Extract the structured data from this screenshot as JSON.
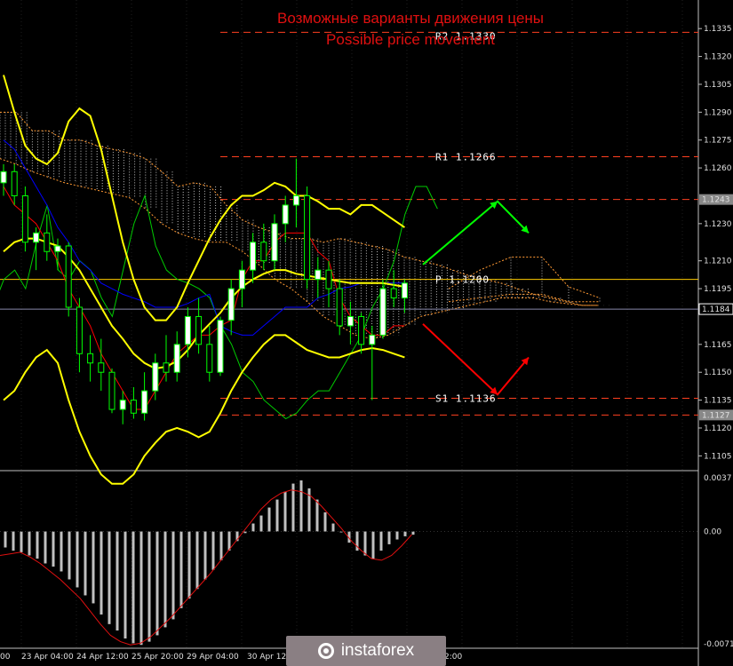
{
  "header": {
    "title_ru": "Возможные варианты движения цены",
    "title_en": "Possible price movement"
  },
  "logo": {
    "text": "instaforex"
  },
  "colors": {
    "background": "#000000",
    "bull_candle": "#ffffff",
    "bear_candle": "#000000",
    "candle_wick": "#00ff00",
    "bollinger": "#ffff00",
    "kijun": "#ff0000",
    "tenkun": "#0000ff",
    "chikou": "#00cc00",
    "level_line": "#ff4020",
    "pivot_line": "#ffcc00",
    "up_arrow": "#00ff00",
    "down_arrow": "#ff0000",
    "kumo": "#ff9933"
  },
  "chart_data": [
    {
      "type": "line",
      "title": "",
      "ylim": [
        1.1098,
        1.1348
      ],
      "y_ticks": [
        "1.1335",
        "1.1320",
        "1.1305",
        "1.1290",
        "1.1275",
        "1.1260",
        "1.1243",
        "1.1230",
        "1.1210",
        "1.1195",
        "1.1184",
        "1.1165",
        "1.1150",
        "1.1135",
        "1.1127",
        "1.1120",
        "1.1105"
      ],
      "x_ticks": [
        "00",
        "23 Apr 04:00",
        "24 Apr 12:00",
        "25 Apr 20:00",
        "29 Apr 04:00",
        "30 Apr 12:00",
        "2:00"
      ],
      "levels": [
        {
          "label": "R2",
          "value": "1.1330",
          "price": 1.1333
        },
        {
          "label": "R1",
          "value": "1.1266",
          "price": 1.1266
        },
        {
          "label": "P",
          "value": "1.1200",
          "price": 1.12
        },
        {
          "label": "S1",
          "value": "1.1136",
          "price": 1.1136
        }
      ],
      "price_tags": [
        {
          "value": "1.1243",
          "price": 1.1243
        },
        {
          "value": "1.1184",
          "price": 1.1184
        },
        {
          "value": "1.1127",
          "price": 1.1127
        }
      ],
      "candles": [
        [
          1.1252,
          1.1262,
          1.1245,
          1.1258
        ],
        [
          1.1258,
          1.1262,
          1.124,
          1.1245
        ],
        [
          1.1245,
          1.125,
          1.1215,
          1.122
        ],
        [
          1.122,
          1.1228,
          1.1205,
          1.1225
        ],
        [
          1.1225,
          1.1235,
          1.121,
          1.1215
        ],
        [
          1.1215,
          1.1222,
          1.1205,
          1.1218
        ],
        [
          1.1218,
          1.122,
          1.118,
          1.1185
        ],
        [
          1.1185,
          1.119,
          1.115,
          1.116
        ],
        [
          1.116,
          1.117,
          1.1145,
          1.1155
        ],
        [
          1.1155,
          1.1168,
          1.114,
          1.115
        ],
        [
          1.115,
          1.1152,
          1.1128,
          1.113
        ],
        [
          1.113,
          1.114,
          1.1122,
          1.1135
        ],
        [
          1.1135,
          1.1142,
          1.1125,
          1.1128
        ],
        [
          1.1128,
          1.115,
          1.1124,
          1.114
        ],
        [
          1.114,
          1.116,
          1.1135,
          1.1155
        ],
        [
          1.1155,
          1.117,
          1.1145,
          1.115
        ],
        [
          1.115,
          1.1172,
          1.1145,
          1.1165
        ],
        [
          1.1165,
          1.1185,
          1.1158,
          1.118
        ],
        [
          1.118,
          1.119,
          1.116,
          1.1165
        ],
        [
          1.1165,
          1.1175,
          1.1145,
          1.115
        ],
        [
          1.115,
          1.118,
          1.1148,
          1.1178
        ],
        [
          1.1178,
          1.12,
          1.117,
          1.1195
        ],
        [
          1.1195,
          1.121,
          1.1185,
          1.1205
        ],
        [
          1.1205,
          1.1225,
          1.1198,
          1.122
        ],
        [
          1.122,
          1.123,
          1.1205,
          1.121
        ],
        [
          1.121,
          1.1235,
          1.1205,
          1.123
        ],
        [
          1.123,
          1.1245,
          1.122,
          1.124
        ],
        [
          1.124,
          1.1265,
          1.1228,
          1.1245
        ],
        [
          1.1245,
          1.125,
          1.1195,
          1.12
        ],
        [
          1.12,
          1.1212,
          1.119,
          1.1205
        ],
        [
          1.1205,
          1.121,
          1.1185,
          1.1195
        ],
        [
          1.1195,
          1.12,
          1.117,
          1.1175
        ],
        [
          1.1175,
          1.1188,
          1.1165,
          1.118
        ],
        [
          1.118,
          1.1182,
          1.116,
          1.1165
        ],
        [
          1.1165,
          1.1175,
          1.1135,
          1.117
        ],
        [
          1.117,
          1.12,
          1.1168,
          1.1195
        ],
        [
          1.1195,
          1.1205,
          1.1185,
          1.119
        ],
        [
          1.119,
          1.12,
          1.1182,
          1.1198
        ]
      ],
      "bollinger_upper": [
        1.131,
        1.129,
        1.1272,
        1.1265,
        1.1262,
        1.1268,
        1.1285,
        1.1292,
        1.1288,
        1.127,
        1.1245,
        1.122,
        1.12,
        1.1185,
        1.1178,
        1.1178,
        1.1185,
        1.1198,
        1.121,
        1.1222,
        1.1232,
        1.124,
        1.1245,
        1.1245,
        1.1248,
        1.1252,
        1.125,
        1.1245,
        1.1245,
        1.1242,
        1.1238,
        1.1238,
        1.1235,
        1.124,
        1.124,
        1.1236,
        1.1232,
        1.1228
      ],
      "bollinger_mid": [
        1.1215,
        1.122,
        1.1222,
        1.1222,
        1.122,
        1.1218,
        1.1212,
        1.1205,
        1.1195,
        1.1185,
        1.1175,
        1.1168,
        1.116,
        1.1155,
        1.1152,
        1.1153,
        1.1156,
        1.1162,
        1.117,
        1.1176,
        1.1182,
        1.119,
        1.1196,
        1.12,
        1.1203,
        1.1205,
        1.1205,
        1.1203,
        1.1202,
        1.1201,
        1.12,
        1.1199,
        1.1198,
        1.1198,
        1.1198,
        1.1198,
        1.1197,
        1.1196
      ],
      "bollinger_lower": [
        1.1135,
        1.114,
        1.115,
        1.1158,
        1.1162,
        1.1155,
        1.1135,
        1.1118,
        1.1105,
        1.1095,
        1.109,
        1.109,
        1.1095,
        1.1105,
        1.1112,
        1.1118,
        1.112,
        1.1118,
        1.1115,
        1.1118,
        1.1128,
        1.114,
        1.115,
        1.1158,
        1.1165,
        1.117,
        1.117,
        1.1166,
        1.1162,
        1.116,
        1.1158,
        1.1158,
        1.116,
        1.1162,
        1.1163,
        1.1162,
        1.116,
        1.1158
      ],
      "kijun": [
        1.125,
        1.124,
        1.1235,
        1.123,
        1.122,
        1.121,
        1.1195,
        1.1185,
        1.1175,
        1.116,
        1.115,
        1.114,
        1.113,
        1.113,
        1.114,
        1.115,
        1.116,
        1.1165,
        1.117,
        1.117,
        1.1175,
        1.1178,
        1.12,
        1.121,
        1.121,
        1.122,
        1.1225,
        1.1225,
        1.1225,
        1.1215,
        1.121,
        1.119,
        1.118,
        1.1175,
        1.117,
        1.117,
        1.1175,
        1.1175
      ],
      "tenkan": [
        1.1275,
        1.127,
        1.126,
        1.125,
        1.124,
        1.1228,
        1.122,
        1.121,
        1.1205,
        1.1198,
        1.1195,
        1.1192,
        1.119,
        1.1188,
        1.1185,
        1.1185,
        1.1185,
        1.1187,
        1.119,
        1.1192,
        1.1175,
        1.1172,
        1.117,
        1.117,
        1.1175,
        1.118,
        1.1185,
        1.1185,
        1.1185,
        1.119,
        1.1192,
        1.1195,
        1.1196,
        1.1198,
        1.1198,
        1.1198,
        1.1198,
        1.1198
      ],
      "chikou": [
        1.1165,
        1.1185,
        1.12,
        1.1205,
        1.1195,
        1.122,
        1.124,
        1.1205,
        1.12,
        1.121,
        1.1205,
        1.119,
        1.118,
        1.1205,
        1.123,
        1.1245,
        1.1218,
        1.1205,
        1.12,
        1.1198,
        1.1195,
        1.119,
        1.1175,
        1.1165,
        1.115,
        1.1145,
        1.1135,
        1.113,
        1.1125,
        1.1128,
        1.1135,
        1.114,
        1.114,
        1.115,
        1.116,
        1.117,
        1.1185,
        1.1195,
        1.121,
        1.1235,
        1.125,
        1.125,
        1.1238
      ],
      "kumo_top": [
        1.129,
        1.129,
        1.128,
        1.128,
        1.1275,
        1.1275,
        1.1272,
        1.127,
        1.1268,
        1.1265,
        1.1258,
        1.125,
        1.1252,
        1.125,
        1.124,
        1.1232,
        1.1228,
        1.1225,
        1.1222,
        1.1222,
        1.122,
        1.1222,
        1.122,
        1.1218,
        1.1216,
        1.1212,
        1.121,
        1.1208,
        1.1205,
        1.1202,
        1.12,
        1.1198,
        1.1195,
        1.1192,
        1.119,
        1.1188,
        1.1186,
        1.1186
      ],
      "kumo_bottom": [
        1.1265,
        1.1262,
        1.1258,
        1.1255,
        1.1252,
        1.125,
        1.1248,
        1.1246,
        1.1244,
        1.1238,
        1.123,
        1.1225,
        1.1222,
        1.122,
        1.122,
        1.1215,
        1.1208,
        1.12,
        1.1195,
        1.1188,
        1.118,
        1.1175,
        1.117,
        1.1168,
        1.117,
        1.1175,
        1.118,
        1.1182,
        1.1184,
        1.1186,
        1.1188,
        1.119,
        1.119,
        1.119,
        1.1188,
        1.1187,
        1.1186,
        1.1186
      ],
      "forecast_up": [
        [
          1.1208,
          0
        ],
        [
          1.1242,
          1
        ],
        [
          1.1225,
          2
        ]
      ],
      "forecast_down": [
        [
          1.1176,
          0
        ],
        [
          1.1138,
          1
        ],
        [
          1.1158,
          2
        ]
      ]
    },
    {
      "type": "bar",
      "title": "",
      "ylim": [
        -0.0072,
        0.0037
      ],
      "y_ticks": [
        "0.0037",
        "0.00",
        "-0.00715"
      ],
      "values": [
        -0.001,
        -0.0012,
        -0.0013,
        -0.0015,
        -0.0017,
        -0.002,
        -0.0022,
        -0.0025,
        -0.003,
        -0.0035,
        -0.004,
        -0.0045,
        -0.0052,
        -0.0058,
        -0.0062,
        -0.0067,
        -0.007,
        -0.0071,
        -0.0069,
        -0.0065,
        -0.006,
        -0.0055,
        -0.0048,
        -0.0042,
        -0.0036,
        -0.003,
        -0.0024,
        -0.0018,
        -0.0012,
        -0.0006,
        -0.0001,
        0.0005,
        0.001,
        0.0015,
        0.002,
        0.0025,
        0.003,
        0.0032,
        0.0027,
        0.002,
        0.0012,
        0.0005,
        0.0,
        -0.0007,
        -0.0012,
        -0.0015,
        -0.0017,
        -0.0012,
        -0.0008,
        -0.0005,
        -0.0003,
        -0.0002
      ],
      "signal": [
        -0.0015,
        -0.0014,
        -0.0013,
        -0.0016,
        -0.002,
        -0.0025,
        -0.003,
        -0.0036,
        -0.0042,
        -0.005,
        -0.0058,
        -0.0065,
        -0.0069,
        -0.0071,
        -0.007,
        -0.0066,
        -0.006,
        -0.0054,
        -0.0047,
        -0.004,
        -0.0033,
        -0.0026,
        -0.0018,
        -0.001,
        -0.0002,
        0.0006,
        0.0014,
        0.002,
        0.0024,
        0.0026,
        0.0025,
        0.0022,
        0.0016,
        0.0009,
        0.0002,
        -0.0006,
        -0.0012,
        -0.0017,
        -0.0018,
        -0.0015,
        -0.0009,
        -0.0002
      ]
    }
  ]
}
